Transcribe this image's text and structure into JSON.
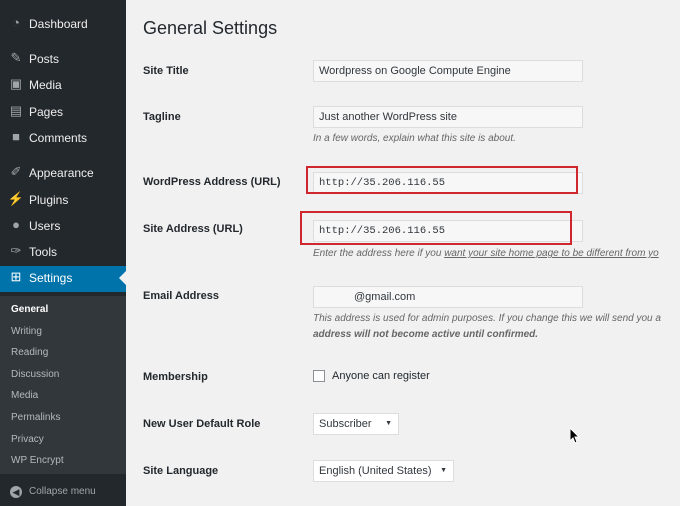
{
  "sidebar": {
    "items": [
      {
        "label": "Dashboard",
        "icon": "dashboard-icon"
      },
      {
        "label": "Posts",
        "icon": "pin-icon"
      },
      {
        "label": "Media",
        "icon": "media-icon"
      },
      {
        "label": "Pages",
        "icon": "pages-icon"
      },
      {
        "label": "Comments",
        "icon": "comments-icon"
      },
      {
        "label": "Appearance",
        "icon": "appearance-icon"
      },
      {
        "label": "Plugins",
        "icon": "plugins-icon"
      },
      {
        "label": "Users",
        "icon": "users-icon"
      },
      {
        "label": "Tools",
        "icon": "tools-icon"
      },
      {
        "label": "Settings",
        "icon": "settings-icon"
      }
    ],
    "submenu": [
      "General",
      "Writing",
      "Reading",
      "Discussion",
      "Media",
      "Permalinks",
      "Privacy",
      "WP Encrypt"
    ],
    "collapse_label": "Collapse menu"
  },
  "main": {
    "title": "General Settings",
    "site_title": {
      "label": "Site Title",
      "value": "Wordpress on Google Compute Engine"
    },
    "tagline": {
      "label": "Tagline",
      "value": "Just another WordPress site",
      "desc": "In a few words, explain what this site is about."
    },
    "wp_address": {
      "label": "WordPress Address (URL)",
      "value": "http://35.206.116.55"
    },
    "site_address": {
      "label": "Site Address (URL)",
      "value": "http://35.206.116.55",
      "desc_pre": "Enter the address here if you ",
      "desc_link": "want your site home page to be different from yo"
    },
    "email": {
      "label": "Email Address",
      "value": "@gmail.com",
      "desc1": "This address is used for admin purposes. If you change this we will send you a",
      "desc2": "address will not become active until confirmed."
    },
    "membership": {
      "label": "Membership",
      "checkbox_label": "Anyone can register"
    },
    "default_role": {
      "label": "New User Default Role",
      "value": "Subscriber"
    },
    "language": {
      "label": "Site Language",
      "value": "English (United States)"
    }
  },
  "colors": {
    "sidebar_bg": "#23282d",
    "active": "#0073aa",
    "highlight": "#d0262e"
  }
}
